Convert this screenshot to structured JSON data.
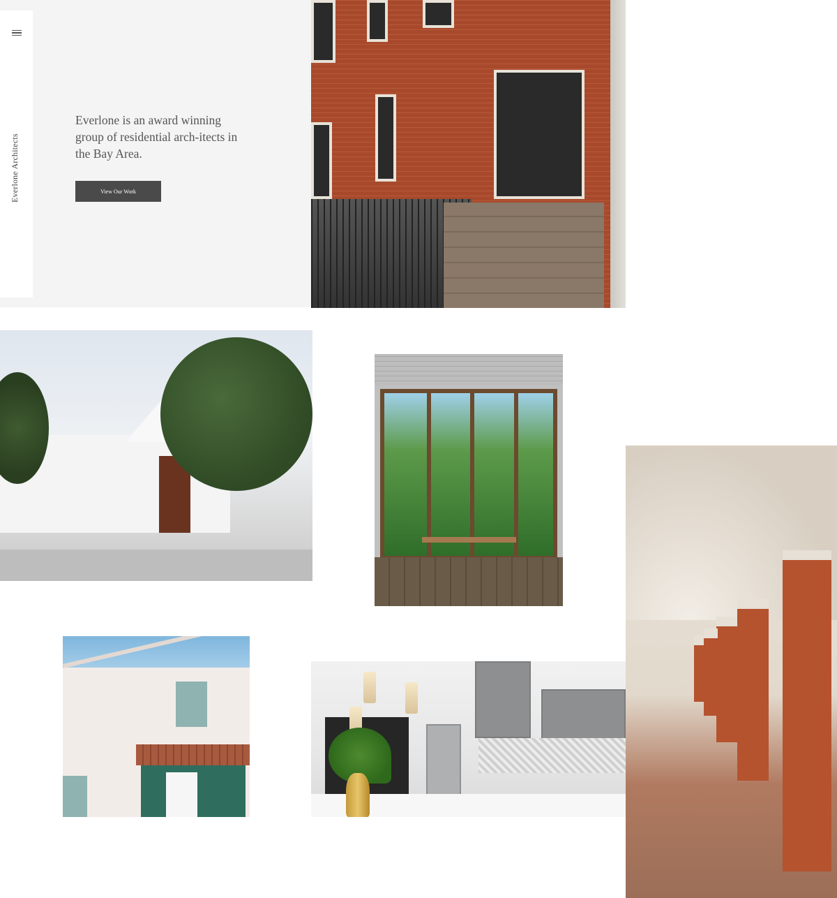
{
  "sidebar": {
    "menu_icon": "hamburger-menu-icon",
    "brand_vertical": "Everlone Architects"
  },
  "hero": {
    "tagline": "Everlone is an award winning group of residential arch-itects in the Bay Area.",
    "cta_label": "View Our Work"
  },
  "gallery": {
    "images": [
      "brick-townhouse-photo",
      "white-modern-house-photo",
      "tropical-window-room-photo",
      "arched-colonnade-photo",
      "white-villa-green-shutters-photo",
      "grey-kitchen-photo"
    ]
  },
  "colors": {
    "hero_background": "#f4f4f4",
    "cta_background": "#4a4a4a",
    "text": "#555555"
  }
}
